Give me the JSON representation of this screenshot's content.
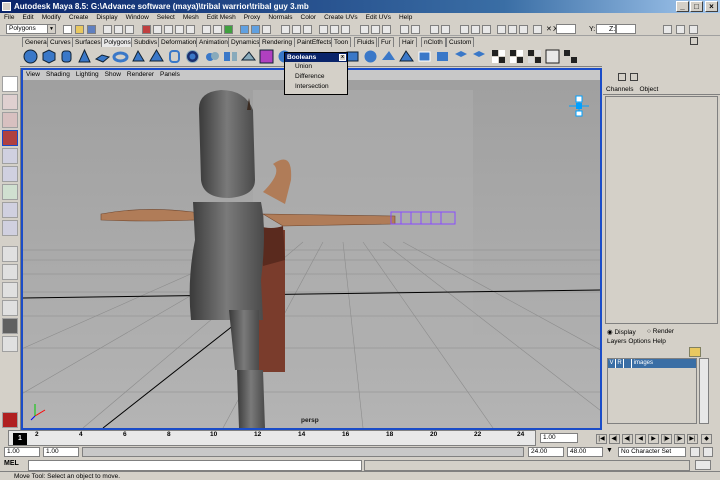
{
  "window": {
    "title": "Autodesk Maya 8.5: G:\\Advance software (maya)\\tribal warrior\\tribal guy 3.mb"
  },
  "menubar": [
    "File",
    "Edit",
    "Modify",
    "Create",
    "Display",
    "Window",
    "Select",
    "Mesh",
    "Edit Mesh",
    "Proxy",
    "Normals",
    "Color",
    "Create UVs",
    "Edit UVs",
    "Help"
  ],
  "statusline": {
    "mode_value": "Polygons",
    "x_label": "X:",
    "y_label": "Y:",
    "z_label": "Z:"
  },
  "shelf_tabs": [
    "General",
    "Curves",
    "Surfaces",
    "Polygons",
    "Subdivs",
    "Deformation",
    "Animation",
    "Dynamics",
    "Rendering",
    "PaintEffects",
    "Toon",
    "Fluids",
    "Fur",
    "Hair",
    "nCloth",
    "Custom"
  ],
  "shelf_active": "Polygons",
  "panel_menu": [
    "View",
    "Shading",
    "Lighting",
    "Show",
    "Renderer",
    "Panels"
  ],
  "camera_label": "persp",
  "booleans_popup": {
    "title": "Booleans",
    "close": "x",
    "items": [
      "Union",
      "Difference",
      "Intersection"
    ]
  },
  "channel_box": {
    "tabs": [
      "Channels",
      "Object"
    ]
  },
  "layer_editor": {
    "display_label": "Display",
    "render_label": "Render",
    "menu": [
      "Layers",
      "Options",
      "Help"
    ],
    "layer_v": "V",
    "layer_r": "R",
    "layer_name": "images"
  },
  "timeline": {
    "ticks": [
      "1",
      "2",
      "4",
      "6",
      "8",
      "10",
      "12",
      "14",
      "16",
      "18",
      "20",
      "22",
      "24"
    ],
    "current_frame": "1.00"
  },
  "range": {
    "start": "1.00",
    "start2": "1.00",
    "end": "24.00",
    "end2": "48.00",
    "character_set": "No Character Set"
  },
  "mel": {
    "label": "MEL"
  },
  "help_line": "Move Tool: Select an object to move.",
  "colors": {
    "viewport_border": "#1a4cc8",
    "title_start": "#0a246a",
    "layer_selected": "#3a6ea5",
    "wire_highlight": "#8a4cff"
  }
}
